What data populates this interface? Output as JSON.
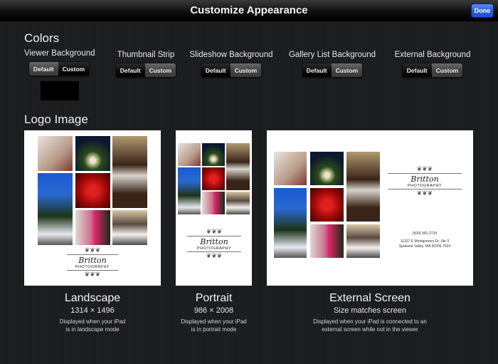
{
  "navbar": {
    "title": "Customize Appearance",
    "done_label": "Done"
  },
  "colors": {
    "title": "Colors",
    "groups": [
      {
        "label": "Viewer Background",
        "default": "Default",
        "custom": "Custom",
        "selected": "custom",
        "swatch": "#000000"
      },
      {
        "label": "Thumbnail Strip",
        "default": "Default",
        "custom": "Custom",
        "selected": "default"
      },
      {
        "label": "Slideshow Background",
        "default": "Default",
        "custom": "Custom",
        "selected": "default"
      },
      {
        "label": "Gallery List Background",
        "default": "Default",
        "custom": "Custom",
        "selected": "default"
      },
      {
        "label": "External Background",
        "default": "Default",
        "custom": "Custom",
        "selected": "default"
      }
    ]
  },
  "logo": {
    "title": "Logo Image",
    "brand_script": "Britton",
    "brand_sub": "PHOTOGRAPHY",
    "phone": "(509) 991-2724",
    "address1": "11327 E Montgomery Dr, Ste 3",
    "address2": "Spokane Valley, WA 99206-7624",
    "options": [
      {
        "title": "Landscape",
        "size": "1314 × 1496",
        "desc1": "Displayed when your iPad",
        "desc2": "is in landscape mode"
      },
      {
        "title": "Portrait",
        "size": "986 × 2008",
        "desc1": "Displayed when your iPad",
        "desc2": "is in portrait mode"
      },
      {
        "title": "External Screen",
        "size": "Size matches screen",
        "desc1": "Displayed when your iPad is connected to an",
        "desc2": "external screen while not in the viewer"
      }
    ]
  }
}
